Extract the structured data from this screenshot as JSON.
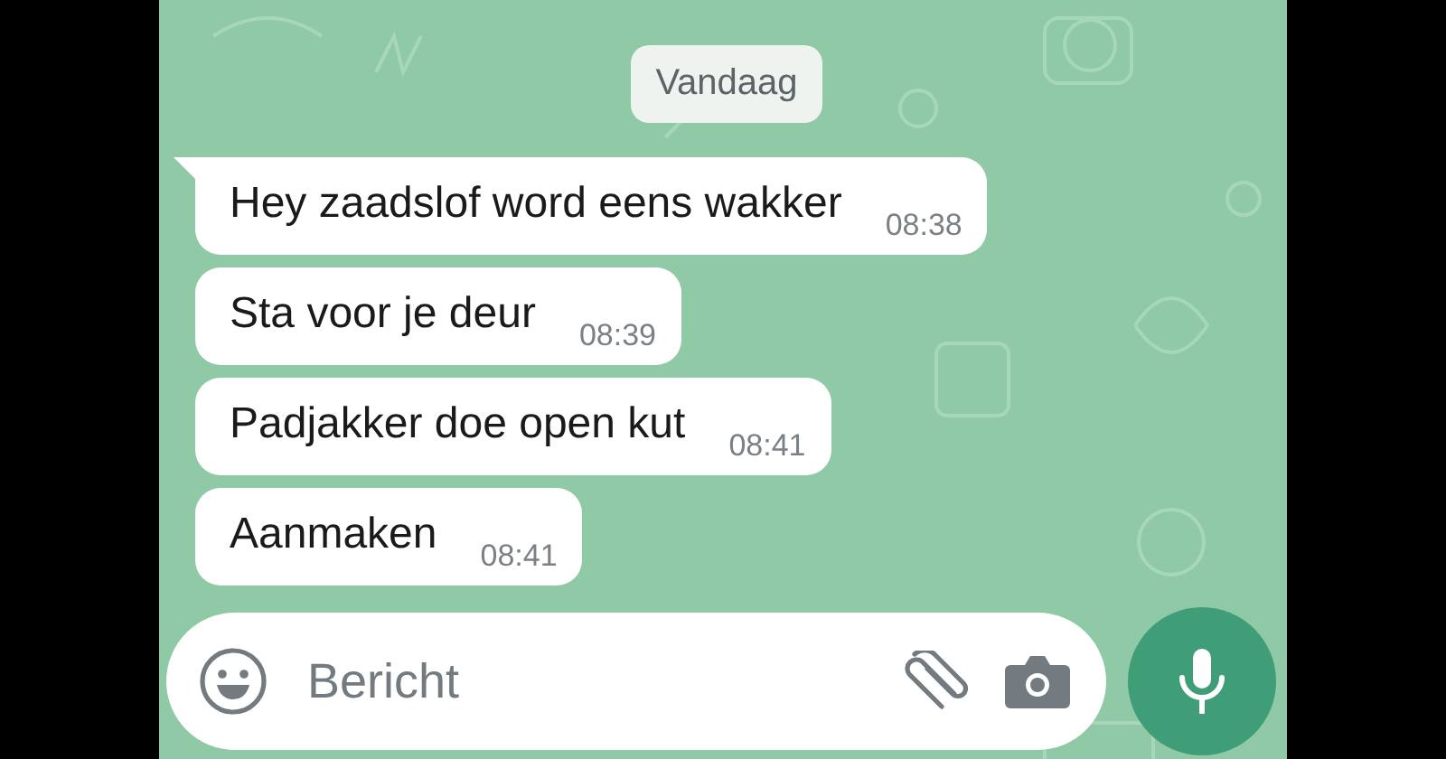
{
  "date_chip": "Vandaag",
  "messages": [
    {
      "text": "Hey zaadslof word eens wakker",
      "time": "08:38",
      "tail": true
    },
    {
      "text": "Sta voor je deur",
      "time": "08:39",
      "tail": false
    },
    {
      "text": "Padjakker doe open kut",
      "time": "08:41",
      "tail": false
    },
    {
      "text": "Aanmaken",
      "time": "08:41",
      "tail": false
    }
  ],
  "composer": {
    "placeholder": "Bericht"
  }
}
